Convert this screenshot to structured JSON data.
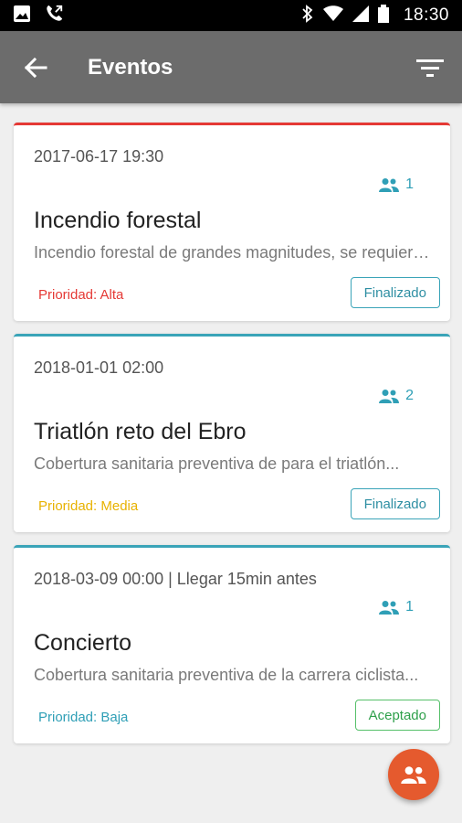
{
  "status_bar": {
    "time": "18:30"
  },
  "app_bar": {
    "title": "Eventos"
  },
  "events": [
    {
      "date": "2017-06-17 19:30",
      "attendees": "1",
      "title": "Incendio forestal",
      "description": "Incendio forestal de grandes magnitudes, se requiere...",
      "priority": "Prioridad: Alta",
      "priority_color": "#e53935",
      "border_color": "#e53935",
      "status": "Finalizado",
      "status_color": "#2f8fa3",
      "status_border": "#3aa4b8"
    },
    {
      "date": "2018-01-01 02:00",
      "attendees": "2",
      "title": "Triatlón reto del Ebro",
      "description": "Cobertura sanitaria preventiva de para el triatlón...",
      "priority": "Prioridad: Media",
      "priority_color": "#e8b200",
      "border_color": "#3aa4b8",
      "status": "Finalizado",
      "status_color": "#2f8fa3",
      "status_border": "#3aa4b8"
    },
    {
      "date": "2018-03-09 00:00 | Llegar 15min antes",
      "attendees": "1",
      "title": "Concierto",
      "description": "Cobertura sanitaria preventiva de la carrera ciclista...",
      "priority": "Prioridad: Baja",
      "priority_color": "#2f9fb6",
      "border_color": "#3aa4b8",
      "status": "Aceptado",
      "status_color": "#2e9f4a",
      "status_border": "#56c06a"
    }
  ],
  "icons": {
    "back": "arrow-left-icon",
    "filter": "filter-icon",
    "people": "people-icon",
    "fab": "group-icon"
  }
}
